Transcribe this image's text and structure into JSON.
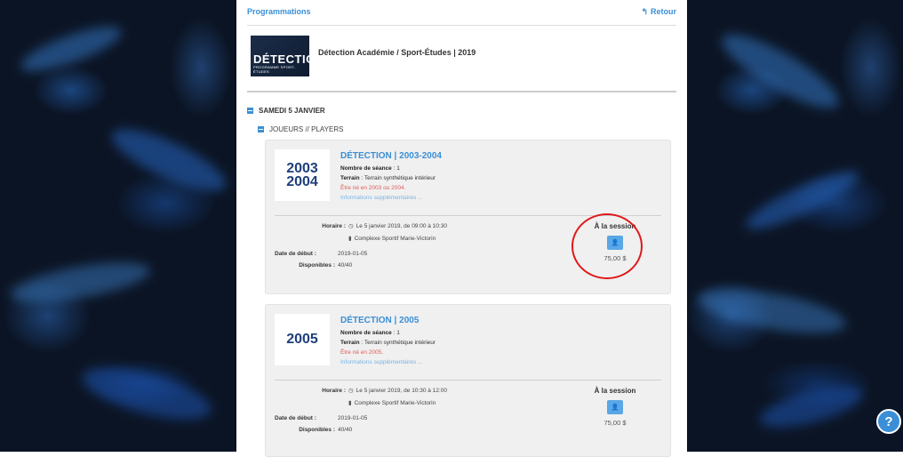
{
  "topbar": {
    "programmations_label": "Programmations",
    "retour_label": "Retour",
    "retour_icon": "reply-arrow-icon"
  },
  "header": {
    "logo_big": "DÉTECTION",
    "logo_small": "PROGRAMME SPORT-ÉTUDES",
    "title": "Détection Académie / Sport-Études | 2019"
  },
  "section": {
    "date_label": "SAMEDI 5 JANVIER",
    "group_label": "JOUEURS // PLAYERS"
  },
  "cards": [
    {
      "year_line1": "2003",
      "year_line2": "2004",
      "title": "DÉTECTION | 2003-2004",
      "seances_label": "Nombre de séance",
      "seances_value": " : 1",
      "terrain_label": "Terrain",
      "terrain_value": " : Terrain synthétique intérieur",
      "requirement": "Être né en 2003 ou 2004.",
      "more_info": "Informations supplémentaires ...",
      "horaire_label": "Horaire :",
      "horaire_value": "Le 5 janvier 2019, de 09:00 à 10:30",
      "location": "Complexe Sportif Marie-Victorin",
      "date_debut_label": "Date de début :",
      "date_debut_value": "2019-01-05",
      "disponibles_label": "Disponibles :",
      "disponibles_value": "40/40",
      "price_label": "À la session",
      "price_value": "75,00 $"
    },
    {
      "year_line1": "2005",
      "year_line2": "",
      "title": "DÉTECTION | 2005",
      "seances_label": "Nombre de séance",
      "seances_value": " : 1",
      "terrain_label": "Terrain",
      "terrain_value": " : Terrain synthétique intérieur",
      "requirement": "Être né en 2005.",
      "more_info": "Informations supplémentaires ...",
      "horaire_label": "Horaire :",
      "horaire_value": "Le 5 janvier 2019, de 10:30 à 12:00",
      "location": "Complexe Sportif Marie-Victorin",
      "date_debut_label": "Date de début :",
      "date_debut_value": "2019-01-05",
      "disponibles_label": "Disponibles :",
      "disponibles_value": "40/40",
      "price_label": "À la session",
      "price_value": "75,00 $"
    }
  ],
  "help": {
    "label": "?"
  },
  "colors": {
    "accent": "#3a8fd6",
    "annotation_circle": "#e01818",
    "requirement_text": "#e05a5a"
  }
}
